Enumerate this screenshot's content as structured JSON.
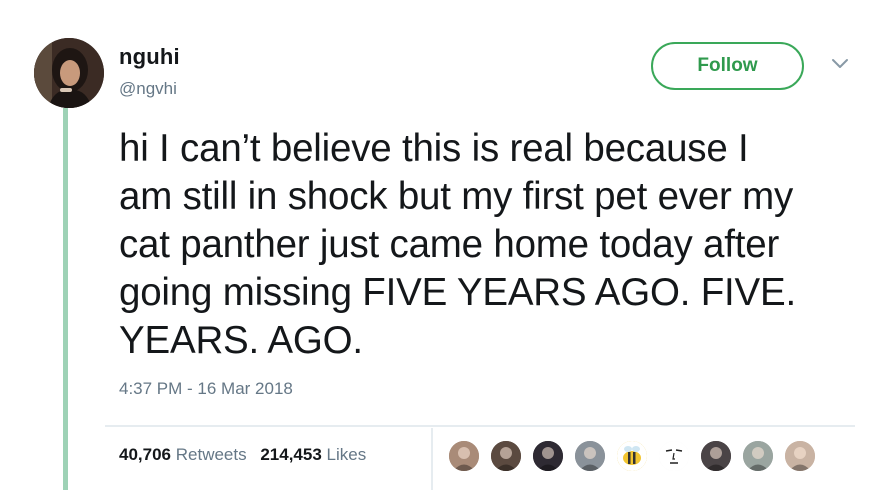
{
  "author": {
    "display_name": "nguhi",
    "handle": "@ngvhi",
    "avatar_icon": "profile-photo"
  },
  "follow_button": {
    "label": "Follow",
    "color": "#2f9a4d"
  },
  "menu_icon": "chevron-down-icon",
  "tweet": {
    "lines": [
      "hi I can’t believe this is real because I",
      "am still in shock but my first pet ever my",
      "cat panther just came home today after",
      "going missing FIVE YEARS AGO. FIVE.",
      "YEARS. AGO."
    ],
    "timestamp": "4:37 PM - 16 Mar 2018"
  },
  "stats": {
    "retweets_count": "40,706",
    "retweets_label": "Retweets",
    "likes_count": "214,453",
    "likes_label": "Likes"
  },
  "liked_by_avatars": [
    {
      "icon": "avatar-photo-1",
      "color": "#a98b78"
    },
    {
      "icon": "avatar-photo-2",
      "color": "#5b4a40"
    },
    {
      "icon": "avatar-photo-3",
      "color": "#2e2a33"
    },
    {
      "icon": "avatar-photo-4",
      "color": "#8a929a"
    },
    {
      "icon": "bee-avatar",
      "color": "#e8c23a"
    },
    {
      "icon": "face-drawing-avatar",
      "color": "#f4f4f4"
    },
    {
      "icon": "avatar-photo-7",
      "color": "#4a4446"
    },
    {
      "icon": "avatar-photo-8",
      "color": "#9aa5a0"
    },
    {
      "icon": "avatar-photo-9",
      "color": "#c9b3a3"
    }
  ],
  "colors": {
    "accent_green": "#3aa859",
    "thread_line": "#9ed2b6",
    "secondary_text": "#657786"
  }
}
